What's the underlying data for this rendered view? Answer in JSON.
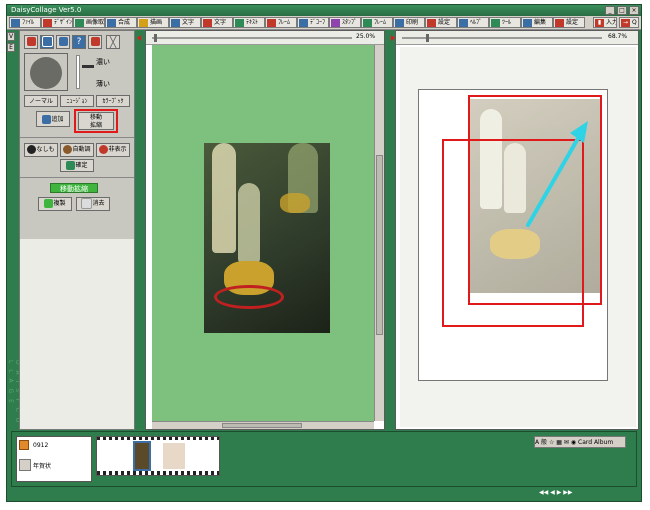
{
  "window": {
    "title": "DaisyCollage Ver5.0",
    "min_label": "_",
    "max_label": "□",
    "close_label": "×"
  },
  "toolbar": {
    "left": [
      {
        "label": "ﾌｧｲﾙ",
        "color": "#3a6ea5"
      },
      {
        "label": "ﾃﾞｻﾞｲﾝ",
        "color": "#c0392b"
      },
      {
        "label": "画像取",
        "color": "#2e8b57"
      },
      {
        "label": "合成",
        "color": "#3a6ea5"
      },
      {
        "label": "描画",
        "color": "#d4a017"
      },
      {
        "label": "文字",
        "color": "#3a6ea5"
      },
      {
        "label": "文字",
        "color": "#c0392b"
      },
      {
        "label": "ﾃｷｽﾄ",
        "color": "#2e8b57"
      },
      {
        "label": "ﾌﾚｰﾑ",
        "color": "#c0392b"
      },
      {
        "label": "ﾃﾞｺｰﾌ",
        "color": "#3a6ea5"
      },
      {
        "label": "ｽﾀﾝﾌﾟ",
        "color": "#8e44ad"
      },
      {
        "label": "ﾌﾚｰﾑ",
        "color": "#2e8b57"
      },
      {
        "label": "印刷",
        "color": "#3a6ea5"
      },
      {
        "label": "設定",
        "color": "#c0392b"
      },
      {
        "label": "ﾍﾙﾌﾟ",
        "color": "#3a6ea5"
      },
      {
        "label": "ﾂｰﾙ",
        "color": "#2e8b57"
      },
      {
        "label": "編集",
        "color": "#3a6ea5"
      },
      {
        "label": "設定",
        "color": "#c0392b"
      }
    ],
    "right": [
      {
        "label": "入力"
      },
      {
        "label": "Q"
      }
    ]
  },
  "left_strip": {
    "letters": "D A I S Y   C O L L A G E",
    "tabs": [
      "V",
      "E"
    ]
  },
  "tool_panel": {
    "density_high": "濃い",
    "density_low": "薄い",
    "btn_normal": "ノーマル",
    "btn_image": "ﾆｭｰｼﾞｮﾝ",
    "btn_color": "ｶﾗｰﾌﾞｯｸ",
    "btn_add": "追加",
    "btn_move": "移動\n拡縮",
    "btn_none": "なしも",
    "btn_auto": "自動調",
    "btn_hide": "非表示",
    "btn_confirm": "確定",
    "section_label": "移動拡縮",
    "btn_copy": "複製",
    "btn_delete": "消去"
  },
  "left_canvas": {
    "zoom": "25.0%"
  },
  "right_canvas": {
    "zoom": "68.7%"
  },
  "filmstrip": {
    "folder": "0912",
    "item_label": "年賀状",
    "tool_labels": [
      "A",
      "般",
      "☆",
      "▦",
      "✉",
      "◉",
      "Card Album"
    ]
  },
  "status": {
    "nav": [
      "◀◀",
      "◀",
      "▶",
      "▶▶"
    ]
  }
}
